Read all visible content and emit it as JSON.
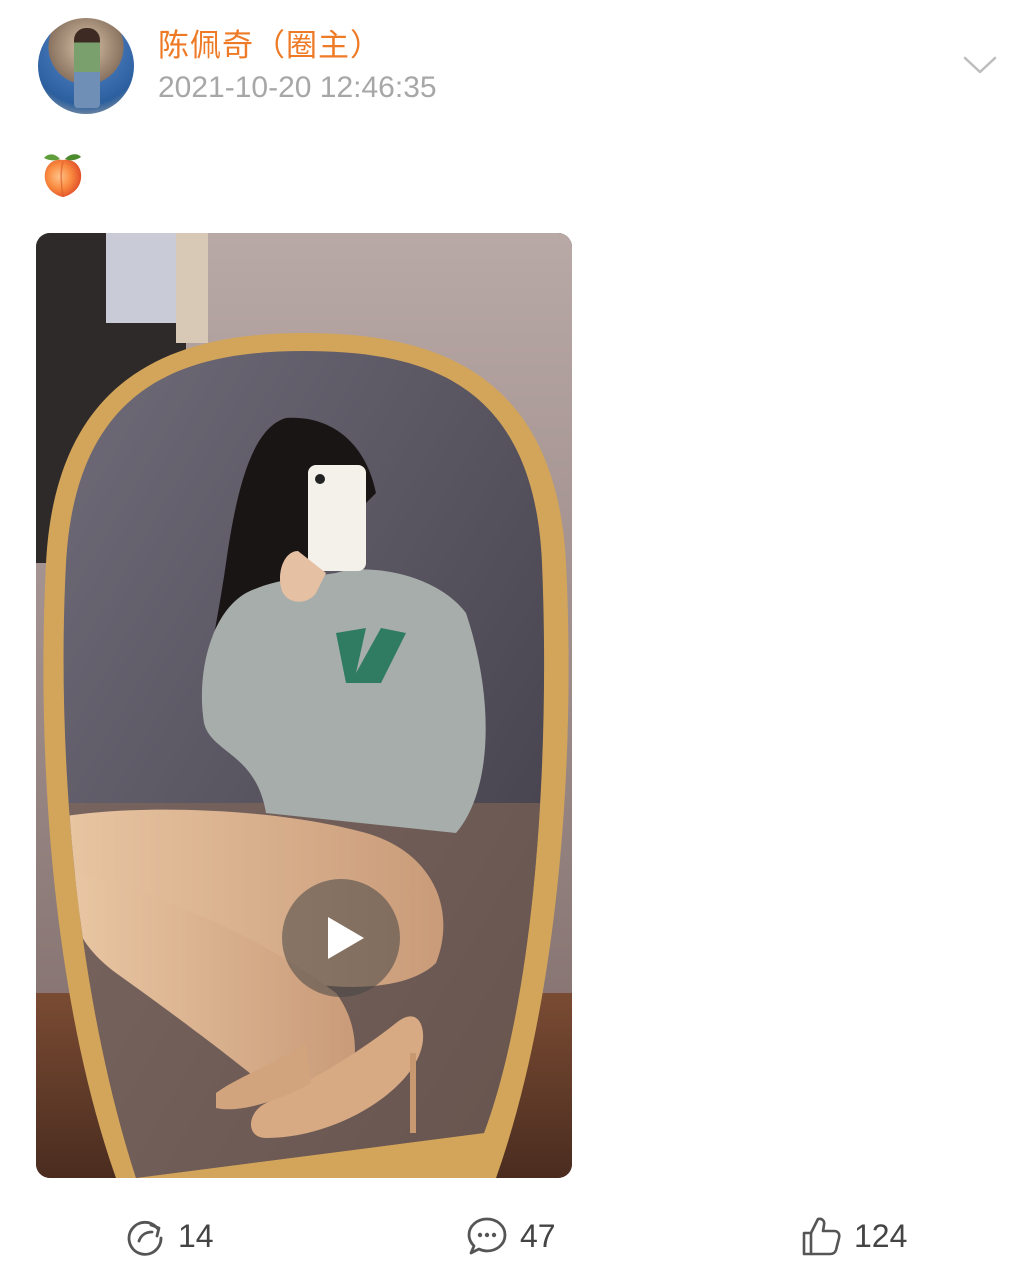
{
  "author": {
    "name": "陈佩奇（圈主）",
    "time": "2021-10-20 12:46:35"
  },
  "post": {
    "emoji": "🍑"
  },
  "actions": {
    "repost_count": "14",
    "comment_count": "47",
    "like_count": "124"
  },
  "colors": {
    "accent": "#ef7a25",
    "muted": "#a7a7a7"
  },
  "icons": {
    "dropdown": "chevron-down-icon",
    "repost": "repost-icon",
    "comment": "comment-icon",
    "like": "thumbs-up-icon",
    "play": "play-icon"
  }
}
